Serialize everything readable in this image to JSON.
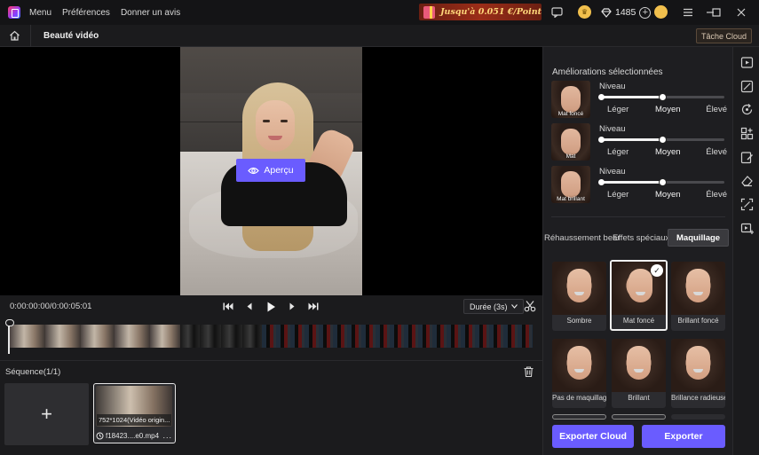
{
  "titlebar": {
    "menu": [
      "Menu",
      "Préférences",
      "Donner un avis"
    ],
    "promo": "Jusqu'à 0.051 €/Point",
    "credits": "1485"
  },
  "header": {
    "title": "Beauté vidéo",
    "cloud_task": "Tâche Cloud"
  },
  "preview": {
    "apercu_label": "Aperçu"
  },
  "controls": {
    "timecode": "0:00:00:00/0:00:05:01",
    "duration": "Durée (3s)"
  },
  "sequence": {
    "title": "Séquence(1/1)",
    "add_label": "+",
    "clip": {
      "resolution": "752*1024(Vidéo origin...",
      "name": "f18423....e0.mp4",
      "more": "..."
    }
  },
  "panel": {
    "section_title": "Améliorations sélectionnées",
    "enhancements": [
      {
        "name": "Mat foncé",
        "level_label": "Niveau",
        "low": "Léger",
        "mid": "Moyen",
        "high": "Élevé",
        "level": 0.5
      },
      {
        "name": "Mat",
        "level_label": "Niveau",
        "low": "Léger",
        "mid": "Moyen",
        "high": "Élevé",
        "level": 0.5
      },
      {
        "name": "Mat brillant",
        "level_label": "Niveau",
        "low": "Léger",
        "mid": "Moyen",
        "high": "Élevé",
        "level": 0.5
      }
    ],
    "tabs": [
      "Réhaussement beauté",
      "Effets spéciaux",
      "Maquillage"
    ],
    "active_tab": "Maquillage",
    "styles": [
      {
        "label": "Sombre",
        "selected": false
      },
      {
        "label": "Mat foncé",
        "selected": true
      },
      {
        "label": "Brillant foncé",
        "selected": false
      },
      {
        "label": "Pas de maquillage",
        "selected": false
      },
      {
        "label": "Brillant",
        "selected": false
      },
      {
        "label": "Brillance radieuse",
        "selected": false
      }
    ],
    "export_cloud": "Exporter Cloud",
    "export": "Exporter"
  },
  "colors": {
    "accent": "#6a5cff",
    "background": "#1b1b1d",
    "panel": "#1e1e21"
  },
  "icons": {
    "toolstrip": [
      "play-box-icon",
      "edit-crop-icon",
      "refresh-face-icon",
      "grid-plus-icon",
      "note-edit-icon",
      "eraser-icon",
      "scan-icon",
      "video-plus-icon"
    ]
  }
}
